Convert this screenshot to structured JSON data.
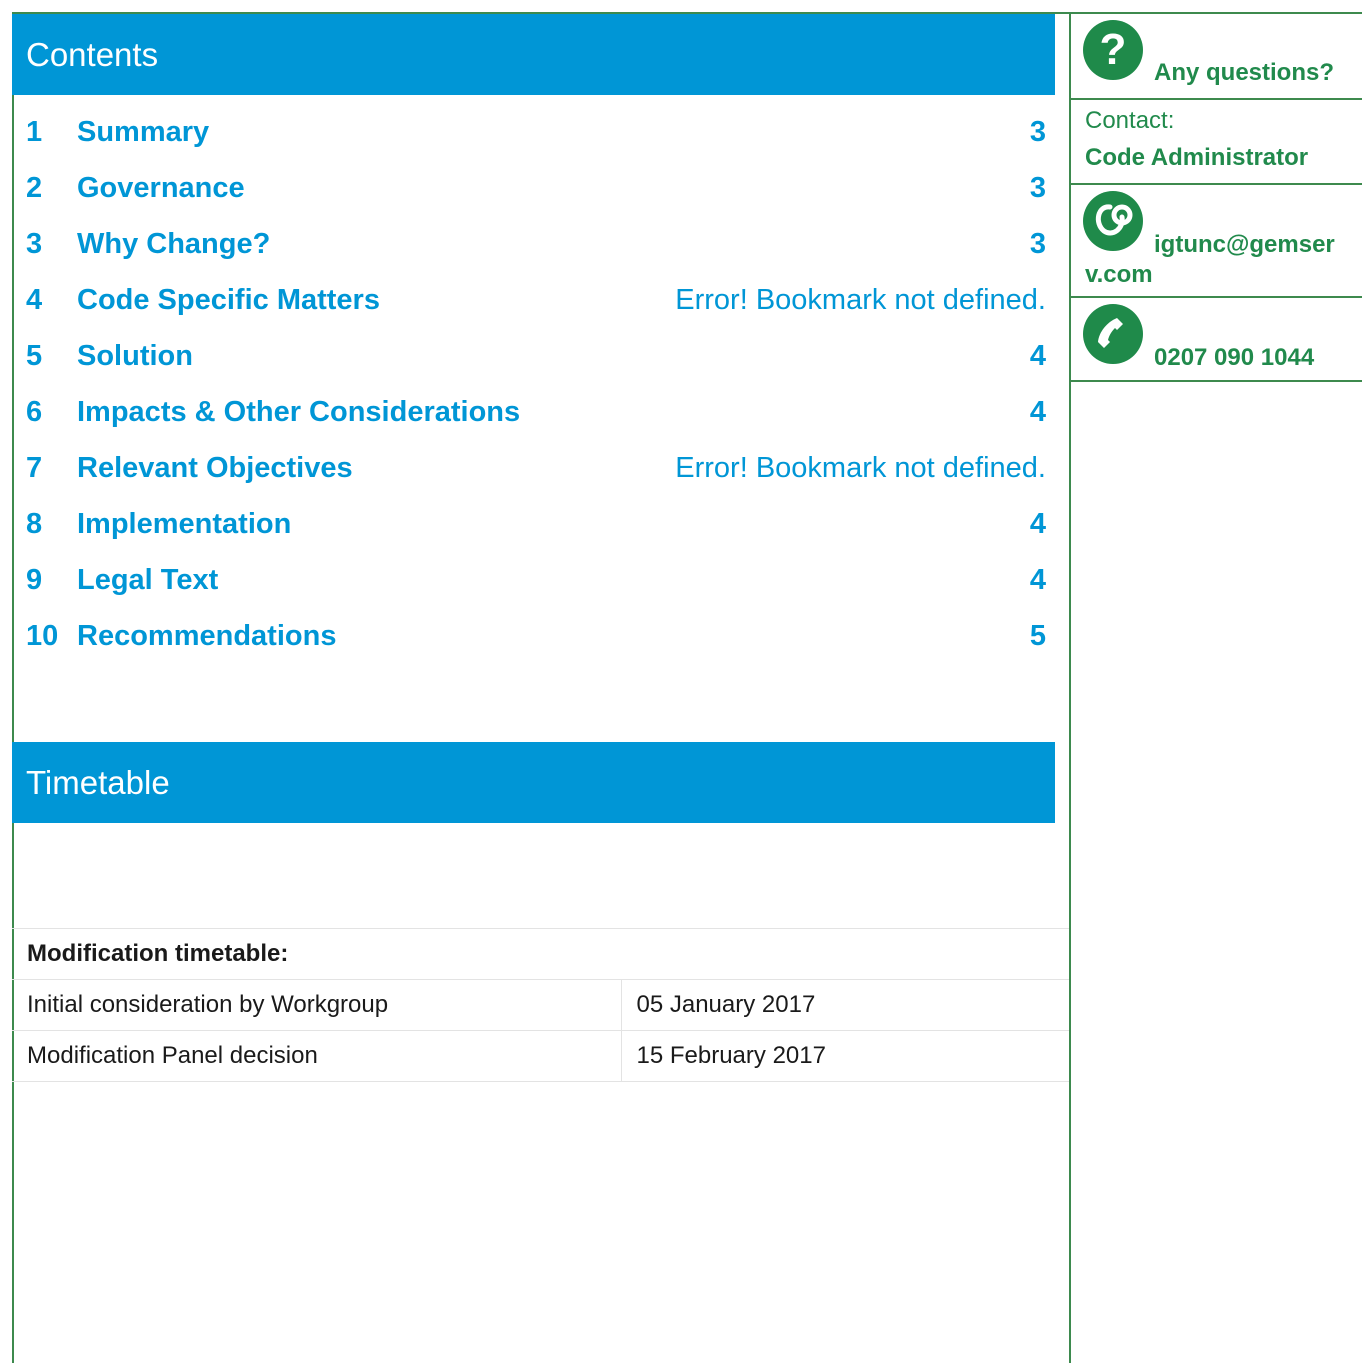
{
  "contents": {
    "heading": "Contents",
    "items": [
      {
        "num": "1",
        "title": "Summary",
        "page": "3"
      },
      {
        "num": "2",
        "title": "Governance",
        "page": "3"
      },
      {
        "num": "3",
        "title": "Why Change?",
        "page": "3"
      },
      {
        "num": "4",
        "title": "Code Specific Matters",
        "page": "Error! Bookmark not defined."
      },
      {
        "num": "5",
        "title": "Solution",
        "page": "4"
      },
      {
        "num": "6",
        "title": "Impacts & Other Considerations",
        "page": "4"
      },
      {
        "num": "7",
        "title": "Relevant Objectives",
        "page": "Error! Bookmark not defined."
      },
      {
        "num": "8",
        "title": "Implementation",
        "page": "4"
      },
      {
        "num": "9",
        "title": "Legal Text",
        "page": "4"
      },
      {
        "num": "10",
        "title": "Recommendations",
        "page": "5"
      }
    ]
  },
  "timetable": {
    "heading": "Timetable",
    "table_title": "Modification timetable:",
    "rows": [
      {
        "label": "Initial consideration by Workgroup",
        "date": "05 January 2017"
      },
      {
        "label": "Modification Panel decision",
        "date": "15 February 2017"
      }
    ]
  },
  "sidebar": {
    "questions": "Any questions?",
    "contact_label": "Contact:",
    "contact_name": "Code Administrator",
    "email_line1": "igtunc@gemser",
    "email_line2": "v.com",
    "phone": "0207 090 1044",
    "icon_names": [
      "question-mark-icon",
      "email-icon",
      "phone-icon"
    ],
    "colors": {
      "accent_blue": "#0096d6",
      "green": "#218a4c",
      "border_green": "#3d8a4e"
    }
  }
}
